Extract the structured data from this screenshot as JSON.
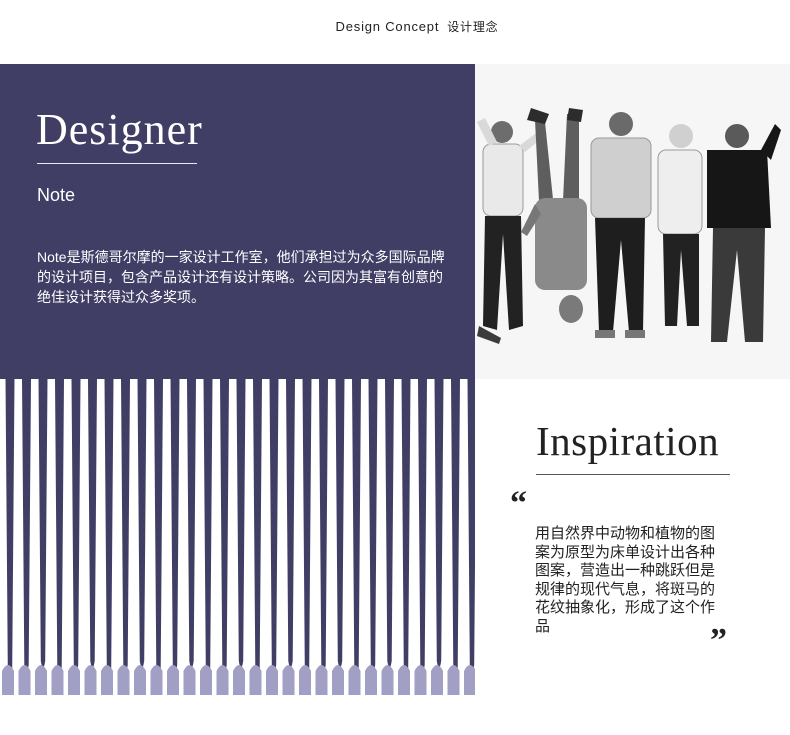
{
  "header": {
    "title_en": "Design Concept",
    "title_cn": "设计理念"
  },
  "designer": {
    "title": "Designer",
    "subtitle": "Note",
    "description": "Note是斯德哥尔摩的一家设计工作室，他们承担过为众多国际品牌的设计项目，包含产品设计还有设计策略。公司因为其富有创意的绝佳设计获得过众多奖项。",
    "panel_color": "#413e66"
  },
  "inspiration": {
    "title": "Inspiration",
    "quote_open": "“",
    "quote_close": "”",
    "text": "用自然界中动物和植物的图案为原型为床单设计出各种图案，营造出一种跳跃但是规律的现代气息，将斑马的花纹抽象化，形成了这个作品"
  },
  "pattern": {
    "stripe_color": "#413e66",
    "tip_color": "#a19fc4"
  },
  "photo": {
    "icon": "team-photo"
  }
}
